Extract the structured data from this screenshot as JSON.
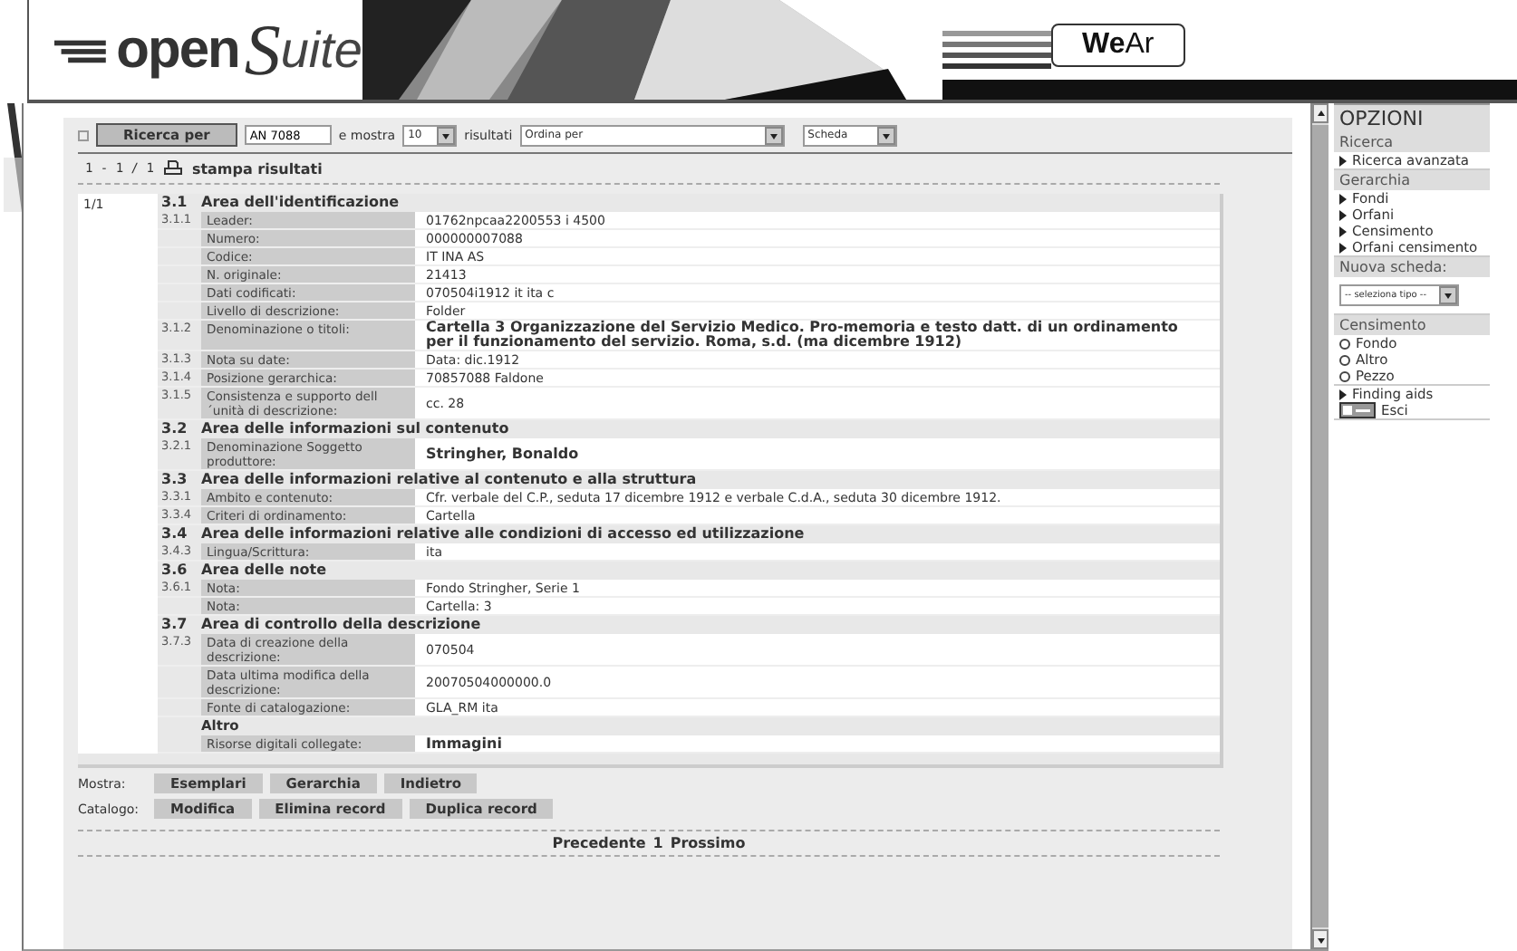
{
  "header": {
    "logo": {
      "part1": "open",
      "part2": "S",
      "part3": "uite"
    },
    "tab": {
      "strong": "We",
      "rest": "Ar"
    }
  },
  "toolbar": {
    "search_button": "Ricerca per",
    "search_value": "AN 7088",
    "show_label": "e mostra",
    "count": "10",
    "results_label": "risultati",
    "order": "Ordina per",
    "view": "Scheda"
  },
  "results": {
    "counter": "1 - 1 / 1",
    "print": "stampa risultati"
  },
  "record": {
    "index": "1/1",
    "rows": [
      {
        "kind": "section",
        "num": "3.1",
        "title": "Area dell'identificazione"
      },
      {
        "kind": "field",
        "num": "3.1.1",
        "label": "Leader:",
        "value": "01762npcaa2200553 i 4500",
        "emphasis": false
      },
      {
        "kind": "field",
        "label": "Numero:",
        "value": "000000007088",
        "emphasis": false
      },
      {
        "kind": "field",
        "label": "Codice:",
        "value": "IT INA AS",
        "emphasis": false
      },
      {
        "kind": "field",
        "label": "N. originale:",
        "value": "21413",
        "emphasis": false
      },
      {
        "kind": "field",
        "label": "Dati codificati:",
        "value": "070504i1912 it ita c",
        "emphasis": false
      },
      {
        "kind": "field",
        "label": "Livello di descrizione:",
        "value": "Folder",
        "emphasis": false
      },
      {
        "kind": "field",
        "num": "3.1.2",
        "label": "Denominazione o titoli:",
        "value": "Cartella 3 Organizzazione del Servizio Medico. Pro-memoria e testo datt. di un ordinamento per il funzionamento del servizio. Roma, s.d. (ma dicembre 1912)",
        "emphasis": true
      },
      {
        "kind": "field",
        "num": "3.1.3",
        "label": "Nota su date:",
        "value": "Data: dic.1912",
        "emphasis": false
      },
      {
        "kind": "field",
        "num": "3.1.4",
        "label": "Posizione gerarchica:",
        "value": "70857088 Faldone",
        "emphasis": false
      },
      {
        "kind": "field",
        "num": "3.1.5",
        "label": "Consistenza e supporto dell´unità di descrizione:",
        "value": "cc. 28",
        "emphasis": false
      },
      {
        "kind": "section",
        "num": "3.2",
        "title": "Area delle informazioni sul contenuto"
      },
      {
        "kind": "field",
        "num": "3.2.1",
        "label": "Denominazione Soggetto produttore:",
        "value": "Stringher, Bonaldo",
        "emphasis": true
      },
      {
        "kind": "section",
        "num": "3.3",
        "title": "Area delle informazioni relative al contenuto e alla struttura"
      },
      {
        "kind": "field",
        "num": "3.3.1",
        "label": "Ambito e contenuto:",
        "value": "Cfr. verbale del C.P., seduta 17 dicembre 1912 e verbale C.d.A., seduta 30 dicembre 1912.",
        "emphasis": false
      },
      {
        "kind": "field",
        "num": "3.3.4",
        "label": "Criteri di ordinamento:",
        "value": "Cartella",
        "emphasis": false
      },
      {
        "kind": "section",
        "num": "3.4",
        "title": "Area delle informazioni relative alle condizioni di accesso ed utilizzazione"
      },
      {
        "kind": "field",
        "num": "3.4.3",
        "label": "Lingua/Scrittura:",
        "value": "ita",
        "emphasis": false
      },
      {
        "kind": "section",
        "num": "3.6",
        "title": "Area delle note"
      },
      {
        "kind": "field",
        "num": "3.6.1",
        "label": "Nota:",
        "value": "Fondo Stringher, Serie 1",
        "emphasis": false
      },
      {
        "kind": "field",
        "label": "Nota:",
        "value": "Cartella: 3",
        "emphasis": false
      },
      {
        "kind": "section",
        "num": "3.7",
        "title": "Area di controllo della descrizione"
      },
      {
        "kind": "field",
        "num": "3.7.3",
        "label": "Data di creazione della descrizione:",
        "value": "070504",
        "emphasis": false
      },
      {
        "kind": "field",
        "label": "Data ultima modifica della descrizione:",
        "value": "20070504000000.0",
        "emphasis": false
      },
      {
        "kind": "field",
        "label": "Fonte di catalogazione:",
        "value": "GLA_RM ita",
        "emphasis": false
      },
      {
        "kind": "subsection",
        "title": "Altro"
      },
      {
        "kind": "field",
        "label": "Risorse digitali collegate:",
        "value": "Immagini",
        "emphasis": true
      }
    ]
  },
  "actions": [
    {
      "label": "Mostra:",
      "buttons": [
        "Esemplari",
        "Gerarchia",
        "Indietro"
      ]
    },
    {
      "label": "Catalogo:",
      "buttons": [
        "Modifica",
        "Elimina record",
        "Duplica record"
      ]
    }
  ],
  "pagination": {
    "prev": "Precedente",
    "page": "1",
    "next": "Prossimo"
  },
  "sidebar": {
    "title": "OPZIONI",
    "sections": [
      {
        "title": "Ricerca",
        "items": [
          {
            "kind": "link",
            "label": "Ricerca avanzata"
          }
        ]
      },
      {
        "title": "Gerarchia",
        "items": [
          {
            "kind": "link",
            "label": "Fondi"
          },
          {
            "kind": "link",
            "label": "Orfani"
          },
          {
            "kind": "link",
            "label": "Censimento"
          },
          {
            "kind": "link",
            "label": "Orfani censimento"
          }
        ]
      },
      {
        "title": "Nuova scheda:",
        "items": [
          {
            "kind": "select",
            "label": "-- seleziona tipo --"
          }
        ]
      },
      {
        "title": "Censimento",
        "items": [
          {
            "kind": "radio",
            "label": "Fondo",
            "selected": false
          },
          {
            "kind": "radio",
            "label": "Altro",
            "selected": false
          },
          {
            "kind": "radio",
            "label": "Pezzo",
            "selected": false
          }
        ]
      },
      {
        "items": [
          {
            "kind": "link",
            "label": "Finding aids"
          },
          {
            "kind": "exit",
            "label": "Esci"
          }
        ]
      }
    ]
  }
}
